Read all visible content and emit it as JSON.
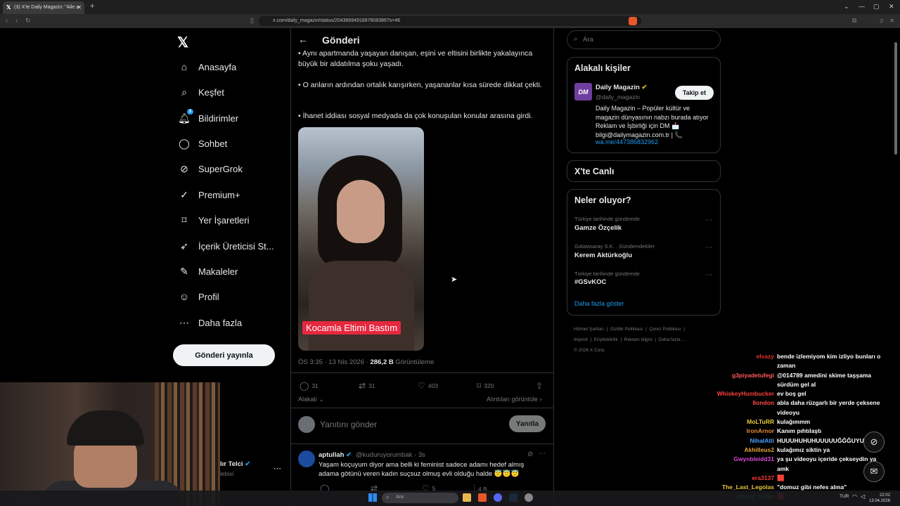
{
  "browser": {
    "tab_title": "(3) X'te Daily Magazin: \"Aile a",
    "url": "x.com/daily_magazin/status/2043669491687608386?s=46"
  },
  "nav": {
    "items": [
      {
        "label": "Anasayfa",
        "icon": "home-icon"
      },
      {
        "label": "Keşfet",
        "icon": "search-icon"
      },
      {
        "label": "Bildirimler",
        "icon": "bell-icon",
        "badge": "3"
      },
      {
        "label": "Sohbet",
        "icon": "chat-icon"
      },
      {
        "label": "SuperGrok",
        "icon": "grok-icon"
      },
      {
        "label": "Premium+",
        "icon": "verified-icon"
      },
      {
        "label": "Yer İşaretleri",
        "icon": "bookmark-icon"
      },
      {
        "label": "İçerik Üreticisi St...",
        "icon": "rocket-icon"
      },
      {
        "label": "Makaleler",
        "icon": "article-icon"
      },
      {
        "label": "Profil",
        "icon": "profile-icon"
      },
      {
        "label": "Daha fazla",
        "icon": "more-circle-icon"
      }
    ],
    "post_button": "Gönderi yayınla",
    "account_name": "lır Telci",
    "account_handle": "lebixi"
  },
  "post": {
    "header": "Gönderi",
    "paragraphs": [
      "• Aynı apartmanda yaşayan danışan, eşini ve eltisini birlikte yakalayınca büyük bir aldatılma şoku yaşadı.",
      "• O anların ardından ortalık karışırken, yaşananlar kısa sürede dikkat çekti.",
      "• İhanet iddiası sosyal medyada da çok konuşulan konular arasına girdi."
    ],
    "video_caption": "Kocamla Eltimi Bastım",
    "time": "ÖS 3:35 · 13 Nis 2026 · ",
    "views": "286,2 B",
    "views_label": " Görüntüleme",
    "stats": {
      "replies": "31",
      "reposts": "31",
      "likes": "403",
      "bookmarks": "320"
    },
    "relevant": "Alakalı",
    "quotes": "Alıntıları görüntüle",
    "reply_placeholder": "Yanıtını gönder",
    "reply_button": "Yanıtla"
  },
  "comment": {
    "name": "aptullah",
    "handle": "@kuduruyorumbak · 3s",
    "text": "Yaşam koçuyum diyor ama belli ki feminist sadece adamı hedef almış adama götünü veren kadın suçsuz olmuş evli olduğu halde 😇😇😇",
    "likes": "5",
    "views": "4 B"
  },
  "sidebar": {
    "search_placeholder": "Ara",
    "relevant_title": "Alakalı kişiler",
    "person": {
      "logo": "DM",
      "name": "Daily Magazin",
      "handle": "@daily_magazin",
      "bio": "Daily Magazin – Popüler kültür ve magazin dünyasının nabzı burada atıyor Reklam ve İşbirliği için DM 📩 bilgi@dailymagazin.com.tr | 📞",
      "link": "wa.me/447386832962",
      "follow": "Takip et"
    },
    "live_title": "X'te Canlı",
    "trends_title": "Neler oluyor?",
    "trends": [
      {
        "context": "Türkiye tarihinde gündemde",
        "name": "Gamze Özçelik"
      },
      {
        "context": "Galatasaray S.K. · Gündemdekiler",
        "name": "Kerem Aktürkoğlu"
      },
      {
        "context": "Türkiye tarihinde gündemde",
        "name": "#GSvKOC"
      }
    ],
    "show_more": "Daha fazla göster",
    "footer": [
      "Hizmet Şartları",
      "Gizlilik Politikası",
      "Çerez Politikası",
      "Imprint",
      "Erişilebilirlik",
      "Reklam bilgisi",
      "Daha fazla ...",
      "© 2026 X Corp."
    ]
  },
  "chat": [
    {
      "user": "elvazy",
      "color": "#e0322b",
      "msg": "bende izlemiyom kim izliyo bunları o"
    },
    {
      "user": "",
      "color": "#ffffff",
      "msg": "zaman"
    },
    {
      "user": "g3piyadetufegi",
      "color": "#ff5a5a",
      "msg": "@014789 amedini skime taşşama"
    },
    {
      "user": "",
      "color": "#ffffff",
      "msg": "sürdüm gel al"
    },
    {
      "user": "WhiskeyHumbucker",
      "color": "#ff4040",
      "msg": "ev boş gel"
    },
    {
      "user": "Ilondon",
      "color": "#ff4a4a",
      "msg": "abla daha rüzgarlı bir yerde çeksene"
    },
    {
      "user": "",
      "color": "#ffffff",
      "msg": "videoyu"
    },
    {
      "user": "MoLTuRR",
      "color": "#e8c93a",
      "msg": "kulağımmm"
    },
    {
      "user": "IronArnor",
      "color": "#e88a3a",
      "msg": "Kanım pıhtılaştı"
    },
    {
      "user": "NihalAtli",
      "color": "#4aa0ff",
      "msg": "HUUUHUHUHUUUUUĞĞĞUYUUHHH"
    },
    {
      "user": "Akhilleus2",
      "color": "#e8a33a",
      "msg": "kulağımız siktin ya"
    },
    {
      "user": "Gwynbleidd31",
      "color": "#d64ad6",
      "msg": "ya şu videoyu içeride çekseydin ya"
    },
    {
      "user": "",
      "color": "#ffffff",
      "msg": "amk"
    },
    {
      "user": "era3137",
      "color": "#ff3a3a",
      "msg": "🟥"
    },
    {
      "user": "The_Last_Legolas",
      "color": "#e8c93a",
      "msg": "\"domuz gibi nefes alma\""
    },
    {
      "user": "young_rasim",
      "color": "#3ad64a",
      "msg": "🟥"
    }
  ],
  "taskbar": {
    "search": "Ara",
    "lang": "TUR",
    "time": "22:02",
    "date": "13.04.2026"
  }
}
